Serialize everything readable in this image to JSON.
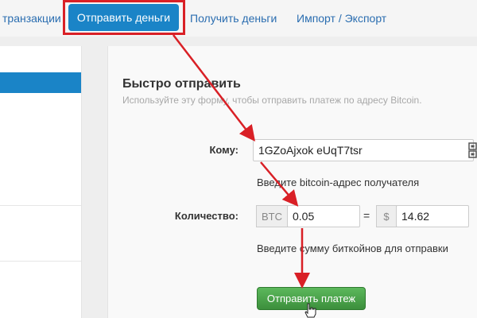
{
  "nav": {
    "tab_transactions": "транзакции",
    "tab_send": "Отправить деньги",
    "tab_receive": "Получить деньги",
    "tab_import_export": "Импорт / Экспорт"
  },
  "form": {
    "title": "Быстро отправить",
    "subtitle": "Используйте эту форму, чтобы отправить платеж по адресу Bitcoin.",
    "to_label": "Кому:",
    "to_value": "1GZoAjxok                    eUqT7tsr",
    "to_help": "Введите bitcoin-адрес получателя",
    "amount_label": "Количество:",
    "btc_addon": "BTC",
    "btc_value": "0.05",
    "equals_sign": "=",
    "usd_addon": "$",
    "usd_value": "14.62",
    "amount_help": "Введите сумму биткойнов для отправки",
    "send_button": "Отправить платеж"
  },
  "colors": {
    "accent": "#1a84c7",
    "annotation_red": "#d92026",
    "button_green": "#4cae4c"
  },
  "icons": {
    "qr": "qr-code-icon",
    "cursor": "hand-pointer-icon"
  }
}
